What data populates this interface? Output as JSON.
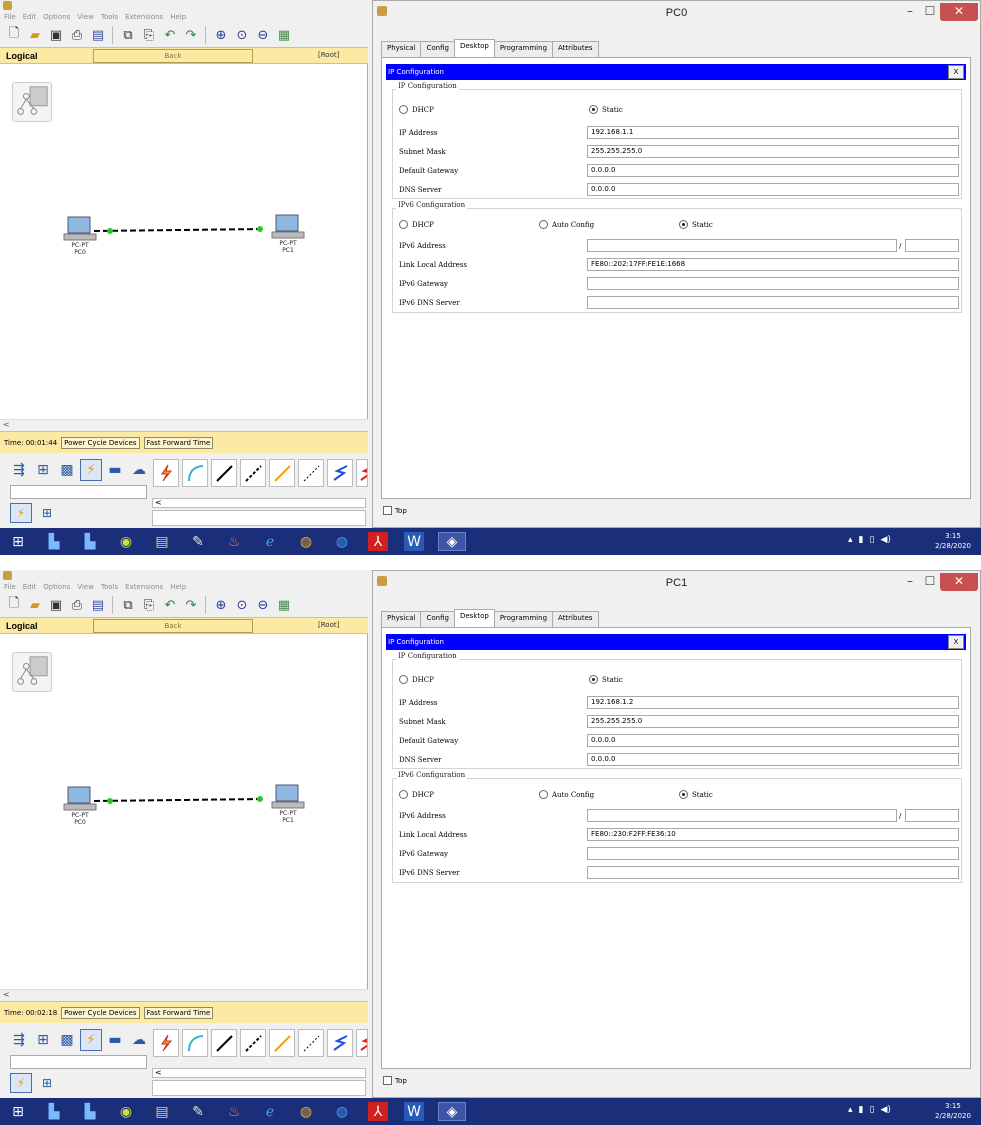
{
  "shared": {
    "menu": [
      "File",
      "Edit",
      "Options",
      "View",
      "Tools",
      "Extensions",
      "Help"
    ],
    "logical_label": "Logical",
    "back_label": "Back",
    "root_label": "[Root]",
    "power_cycle": "Power Cycle Devices",
    "fast_forward": "Fast Forward Time",
    "tabs": [
      "Physical",
      "Config",
      "Desktop",
      "Programming",
      "Attributes"
    ],
    "active_tab": "Desktop",
    "ipconfig_title": "IP Configuration",
    "close_label": "X",
    "ip_group_label": "IP Configuration",
    "dhcp_label": "DHCP",
    "static_label": "Static",
    "auto_config_label": "Auto Config",
    "ip_address_label": "IP Address",
    "subnet_mask_label": "Subnet Mask",
    "default_gateway_label": "Default Gateway",
    "dns_server_label": "DNS Server",
    "ipv6_group_label": "IPv6 Configuration",
    "ipv6_address_label": "IPv6 Address",
    "link_local_label": "Link Local Address",
    "ipv6_gateway_label": "IPv6 Gateway",
    "ipv6_dns_label": "IPv6 DNS Server",
    "top_label": "Top",
    "scroll_arrow": "<",
    "slash": "/",
    "pc0_type": "PC-PT",
    "pc0_name": "PC0",
    "pc1_type": "PC-PT",
    "pc1_name": "PC1",
    "clock_time": "3:15",
    "clock_date": "2/28/2020"
  },
  "screens": [
    {
      "window_title": "PC0",
      "time_label": "Time: 00:01:44",
      "ip_address": "192.168.1.1",
      "subnet_mask": "255.255.255.0",
      "default_gateway": "0.0.0.0",
      "dns_server": "0.0.0.0",
      "ipv6_address": "",
      "ipv6_prefix": "",
      "link_local": "FE80::202:17FF:FE1E:1668",
      "ipv6_gateway": "",
      "ipv6_dns": ""
    },
    {
      "window_title": "PC1",
      "time_label": "Time: 00:02:18",
      "ip_address": "192.168.1.2",
      "subnet_mask": "255.255.255.0",
      "default_gateway": "0.0.0.0",
      "dns_server": "0.0.0.0",
      "ipv6_address": "",
      "ipv6_prefix": "",
      "link_local": "FE80::230:F2FF:FE36:10",
      "ipv6_gateway": "",
      "ipv6_dns": ""
    }
  ],
  "colors": {
    "ipconfig_bar": "#0000ff",
    "logical_bar": "#fce9a4",
    "taskbar": "#1b2e7a",
    "close_button": "#c75050",
    "link_endpoint": "#22cc22"
  },
  "icons": {
    "toolbar": [
      "new-icon",
      "open-icon",
      "save-icon",
      "print-icon",
      "wizard-icon",
      "copy-icon",
      "paste-icon",
      "undo-icon",
      "redo-icon",
      "zoom-in-icon",
      "zoom-reset-icon",
      "zoom-out-icon",
      "palette-icon"
    ],
    "taskbar": [
      "start-icon",
      "explorer-icon",
      "explorer2-icon",
      "app-icon",
      "files-icon",
      "paint-icon",
      "java-icon",
      "ie-icon",
      "chrome-icon",
      "chrome2-icon",
      "acrobat-icon",
      "word-icon",
      "packet-tracer-icon"
    ]
  }
}
